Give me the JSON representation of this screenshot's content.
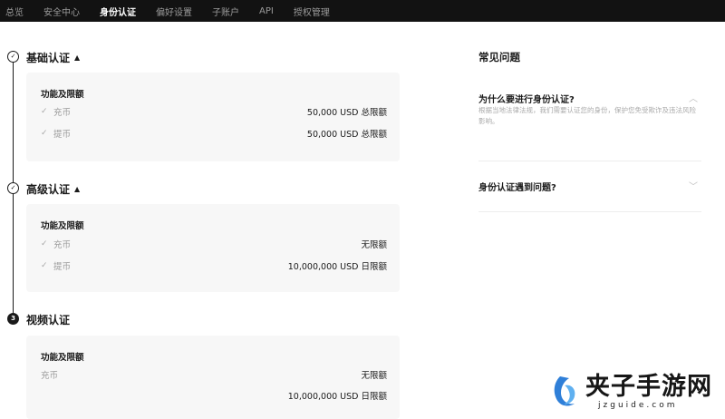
{
  "nav": {
    "items": [
      {
        "label": "总览"
      },
      {
        "label": "安全中心"
      },
      {
        "label": "身份认证",
        "active": true
      },
      {
        "label": "偏好设置"
      },
      {
        "label": "子账户"
      },
      {
        "label": "API"
      },
      {
        "label": "授权管理"
      }
    ]
  },
  "steps": [
    {
      "title": "基础认证",
      "marker": "✓",
      "state": "done",
      "caret": "▲",
      "card_heading": "功能及限额",
      "features": [
        {
          "name": "充币",
          "limit": "50,000 USD 总限额"
        },
        {
          "name": "提币",
          "limit": "50,000 USD 总限额"
        }
      ]
    },
    {
      "title": "高级认证",
      "marker": "✓",
      "state": "done",
      "caret": "▲",
      "card_heading": "功能及限额",
      "features": [
        {
          "name": "充币",
          "limit": "无限额"
        },
        {
          "name": "提币",
          "limit": "10,000,000 USD 日限额"
        }
      ]
    },
    {
      "title": "视频认证",
      "marker": "3",
      "state": "current",
      "card_heading": "功能及限额",
      "features": [
        {
          "name": "充币",
          "limit": "无限额"
        },
        {
          "name": "",
          "limit": "10,000,000 USD 日限额"
        }
      ]
    }
  ],
  "faq": {
    "title": "常见问题",
    "items": [
      {
        "question": "为什么要进行身份认证?",
        "expanded": true,
        "chevron": "︿",
        "answer": "根据当地法律法规，我们需要认证您的身份，保护您免受欺诈及违法风险影响。"
      },
      {
        "question": "身份认证遇到问题?",
        "expanded": false,
        "chevron": "﹀"
      }
    ]
  },
  "watermark": {
    "name": "夹子手游网",
    "url": "jzguide.com"
  },
  "colors": {
    "nav_bg": "#121212",
    "card_bg": "#f7f7f7",
    "text": "#1a1a1a",
    "muted": "#9a9a9a",
    "watermark_blue": "#2f7fd8"
  }
}
